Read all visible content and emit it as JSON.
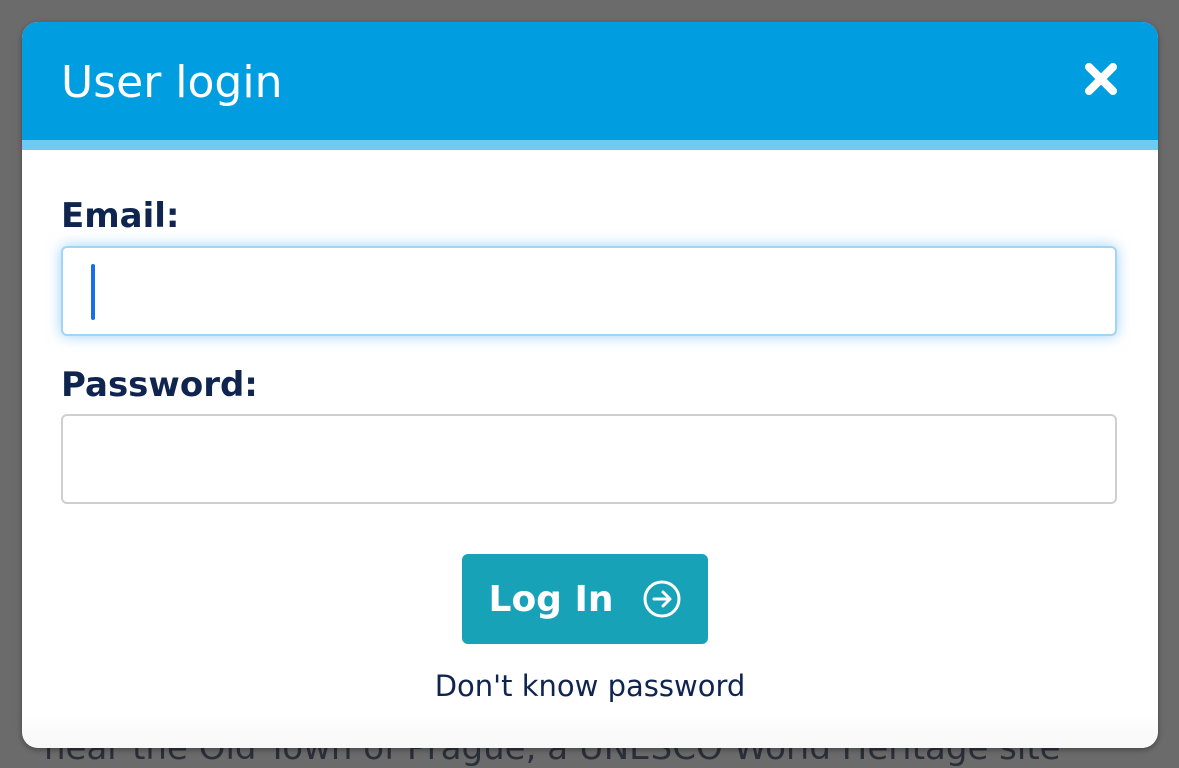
{
  "background": {
    "text": "near the Old Town of Prague, a UNESCO World Heritage site"
  },
  "modal": {
    "title": "User login",
    "close_icon": "close-icon",
    "email_label": "Email:",
    "email_value": "",
    "password_label": "Password:",
    "password_value": "",
    "login_label": "Log In",
    "login_icon": "arrow-right-circle-icon",
    "forgot_label": "Don't know password"
  },
  "colors": {
    "header": "#009ee0",
    "header_stripe": "#6fcaf2",
    "button": "#17a2b8",
    "label_text": "#0f2550",
    "focus_glow": "#9fd6f5"
  }
}
